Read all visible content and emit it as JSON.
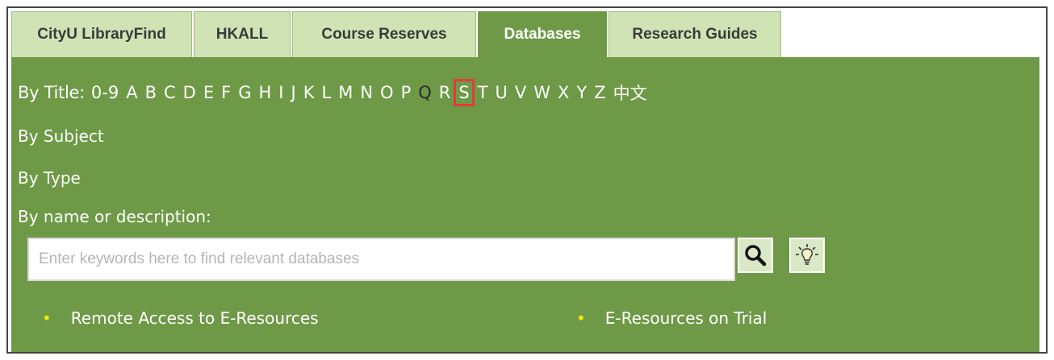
{
  "tabs": [
    {
      "label": "CityU LibraryFind",
      "active": false
    },
    {
      "label": "HKALL",
      "active": false
    },
    {
      "label": "Course Reserves",
      "active": false
    },
    {
      "label": "Databases",
      "active": true
    },
    {
      "label": "Research Guides",
      "active": false
    }
  ],
  "by_title": {
    "label": "By Title:",
    "letters": [
      "0-9",
      "A",
      "B",
      "C",
      "D",
      "E",
      "F",
      "G",
      "H",
      "I",
      "J",
      "K",
      "L",
      "M",
      "N",
      "O",
      "P",
      "Q",
      "R",
      "S",
      "T",
      "U",
      "V",
      "W",
      "X",
      "Y",
      "Z",
      "中文"
    ],
    "highlighted": "S"
  },
  "by_subject": "By Subject",
  "by_type": "By Type",
  "search": {
    "label": "By name or description:",
    "placeholder": "Enter keywords here to find relevant databases",
    "value": ""
  },
  "links": {
    "remote_access": "Remote Access to E-Resources",
    "trial": "E-Resources on Trial"
  },
  "colors": {
    "panel": "#6e9a47",
    "tab_inactive": "#cfe3b5",
    "highlight_box": "#e23b3b",
    "bullet": "#f2e600"
  }
}
